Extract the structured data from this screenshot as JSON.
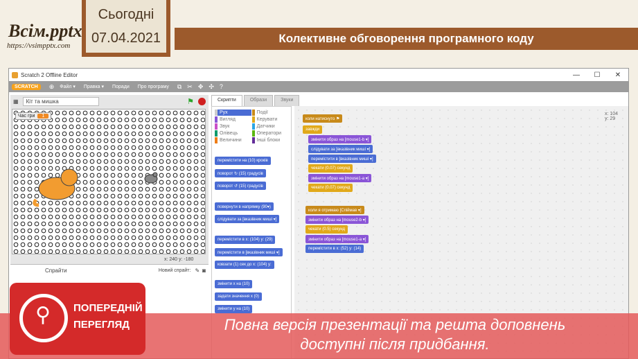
{
  "header": {
    "logo": "Всім.pptx",
    "logo_url": "https://vsimpptx.com",
    "date_label": "Сьогодні",
    "date": "07.04.2021",
    "title": "Колективне обговорення програмного коду"
  },
  "window": {
    "title": "Scratch 2 Offline Editor",
    "minimize": "—",
    "maximize": "☐",
    "close": "✕"
  },
  "menu": {
    "logo": "SCRATCH",
    "items": [
      "Файл ▾",
      "Правка ▾",
      "Поради",
      "Про програму"
    ]
  },
  "stage": {
    "project_name": "Кіт та мишка",
    "variable_name": "Час гри",
    "variable_value": "1",
    "coords": "x: 240  y: -180"
  },
  "sprites": {
    "title": "Спрайти",
    "new_sprite": "Новий спрайт:"
  },
  "tabs": [
    "Скрипти",
    "Образи",
    "Звуки"
  ],
  "categories": [
    "Рух",
    "Події",
    "Вигляд",
    "Керувати",
    "Звук",
    "Датчики",
    "Олівець",
    "Оператори",
    "Величини",
    "Інші блоки"
  ],
  "palette_blocks": [
    "перемістити на (10) кроків",
    "поворот ↻ (15) градусів",
    "поворот ↺ (15) градусів",
    "повернути в напрямку (90▾)",
    "слідувати за [вказівник миші ▾]",
    "перемістити в x: (104) y: (29)",
    "перемістити в [вказівник миші ▾]",
    "ковзати (1) сек до x: (104) y:",
    "змінити x на (10)",
    "задати значення x (0)",
    "змінити y на (10)"
  ],
  "scripts": {
    "script1": [
      "коли натиснуто ⚑",
      "завжди",
      "змінити образ на [mouse1-b ▾]",
      "слідувати за [вказівник миші ▾]",
      "перемістити в [вказівник миші ▾]",
      "чекати (0.07) секунд",
      "змінити образ на [mouse1-a ▾]",
      "чекати (0.07) секунд"
    ],
    "script2": [
      "коли я отримаю [Спіймав ▾]",
      "змінити образ на [mouse2-b ▾]",
      "чекати (0.5) секунд",
      "змінити образ на [mouse1-a ▾]",
      "перемістити в x: (52) y: (14)"
    ],
    "sprite_coords_x": "x: 104",
    "sprite_coords_y": "y: 29"
  },
  "overlay": {
    "badge_line1": "ПОПЕРЕДНІЙ",
    "badge_line2": "ПЕРЕГЛЯД",
    "line1": "Повна версія презентації та решта доповнень",
    "line2": "доступні після придбання."
  }
}
